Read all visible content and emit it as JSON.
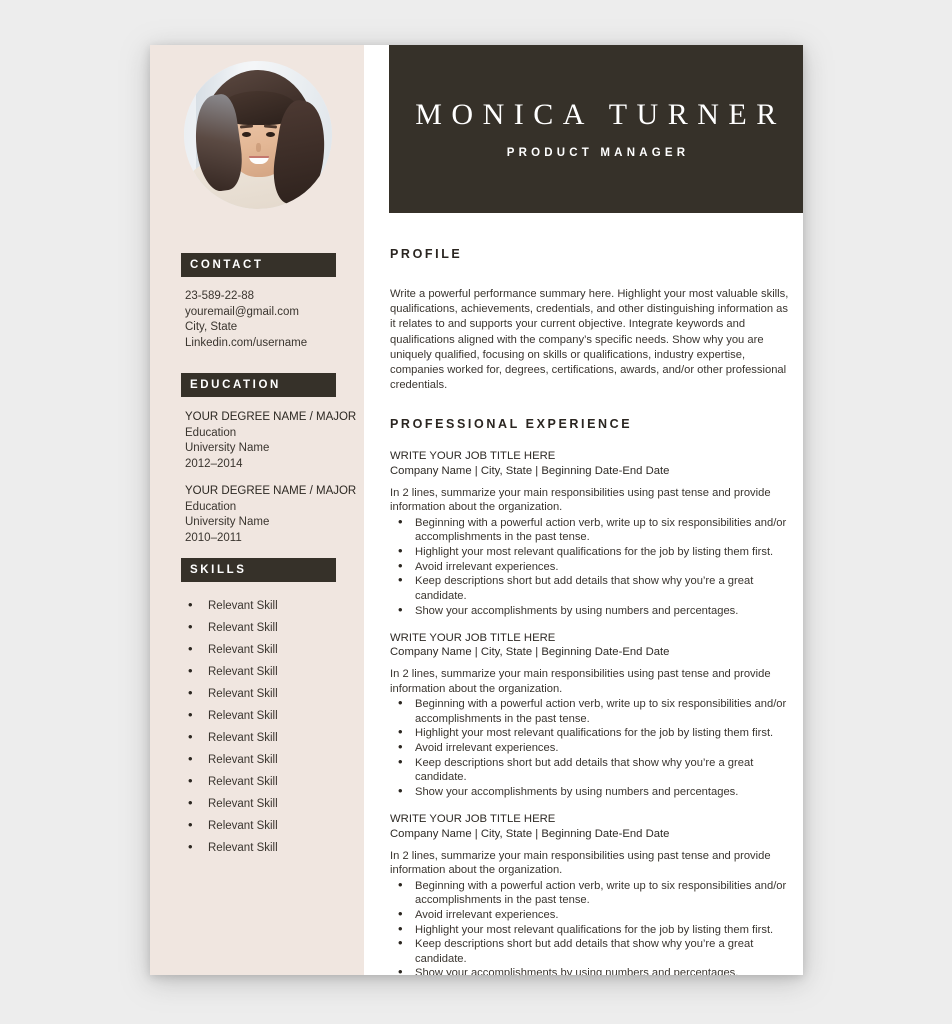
{
  "header": {
    "name": "MONICA TURNER",
    "role": "PRODUCT MANAGER"
  },
  "sidebar": {
    "contact": {
      "heading": "CONTACT",
      "phone": "23-589-22-88",
      "email": "youremail@gmail.com",
      "location": "City, State",
      "linkedin": "Linkedin.com/username"
    },
    "education": {
      "heading": "EDUCATION",
      "entries": [
        {
          "degree": "YOUR DEGREE NAME / MAJOR",
          "level": "Education",
          "school": "University Name",
          "years": "2012–2014"
        },
        {
          "degree": "YOUR DEGREE NAME / MAJOR",
          "level": "Education",
          "school": "University Name",
          "years": "2010–2011"
        }
      ]
    },
    "skills": {
      "heading": "SKILLS",
      "items": [
        "Relevant Skill",
        "Relevant Skill",
        "Relevant Skill",
        "Relevant Skill",
        "Relevant Skill",
        "Relevant Skill",
        "Relevant Skill",
        "Relevant Skill",
        "Relevant Skill",
        "Relevant Skill",
        "Relevant Skill",
        "Relevant Skill"
      ]
    }
  },
  "main": {
    "profile": {
      "heading": "PROFILE",
      "body": "Write a powerful performance summary here. Highlight your most valuable skills, qualifications, achievements, credentials, and other distinguishing information as it relates to and supports your current objective. Integrate keywords and qualifications aligned with the company’s specific needs. Show why you are uniquely qualified, focusing on skills or qualifications, industry expertise, companies worked for, degrees, certifications, awards, and/or other professional credentials."
    },
    "experience": {
      "heading": "PROFESSIONAL EXPERIENCE",
      "jobs": [
        {
          "title": "WRITE YOUR JOB TITLE HERE",
          "meta": "Company Name | City, State | Beginning Date-End Date",
          "summary": "In 2 lines, summarize your main responsibilities using past tense and provide information about the organization.",
          "bullets": [
            "Beginning with a powerful action verb, write up to six responsibilities and/or accomplishments in the past tense.",
            "Highlight your most relevant qualifications for the job by listing them first.",
            "Avoid irrelevant experiences.",
            "Keep descriptions short but add details that show why you’re a great candidate.",
            "Show your accomplishments by using numbers and percentages."
          ]
        },
        {
          "title": "WRITE YOUR JOB TITLE HERE",
          "meta": "Company Name | City, State | Beginning Date-End Date",
          "summary": "In 2 lines, summarize your main responsibilities using past tense and provide information about the organization.",
          "bullets": [
            "Beginning with a powerful action verb, write up to six responsibilities and/or accomplishments in the past tense.",
            "Highlight your most relevant qualifications for the job by listing them first.",
            "Avoid irrelevant experiences.",
            "Keep descriptions short but add details that show why you’re a great candidate.",
            "Show your accomplishments by using numbers and percentages."
          ]
        },
        {
          "title": "WRITE YOUR JOB TITLE HERE",
          "meta": "Company Name | City, State | Beginning Date-End Date",
          "summary": "In 2 lines, summarize your main responsibilities using past tense and provide information about the organization.",
          "bullets": [
            "Beginning with a powerful action verb, write up to six responsibilities and/or accomplishments in the past tense.",
            "Avoid irrelevant experiences.",
            "Highlight your most relevant qualifications for the job by listing them first.",
            "Keep descriptions short but add details that show why you’re a great candidate.",
            "Show your accomplishments by using numbers and percentages."
          ]
        }
      ]
    }
  },
  "colors": {
    "dark": "#363129",
    "sidebar_beige": "#f0e6e0",
    "page_white": "#ffffff",
    "backdrop_gray": "#ededed"
  }
}
